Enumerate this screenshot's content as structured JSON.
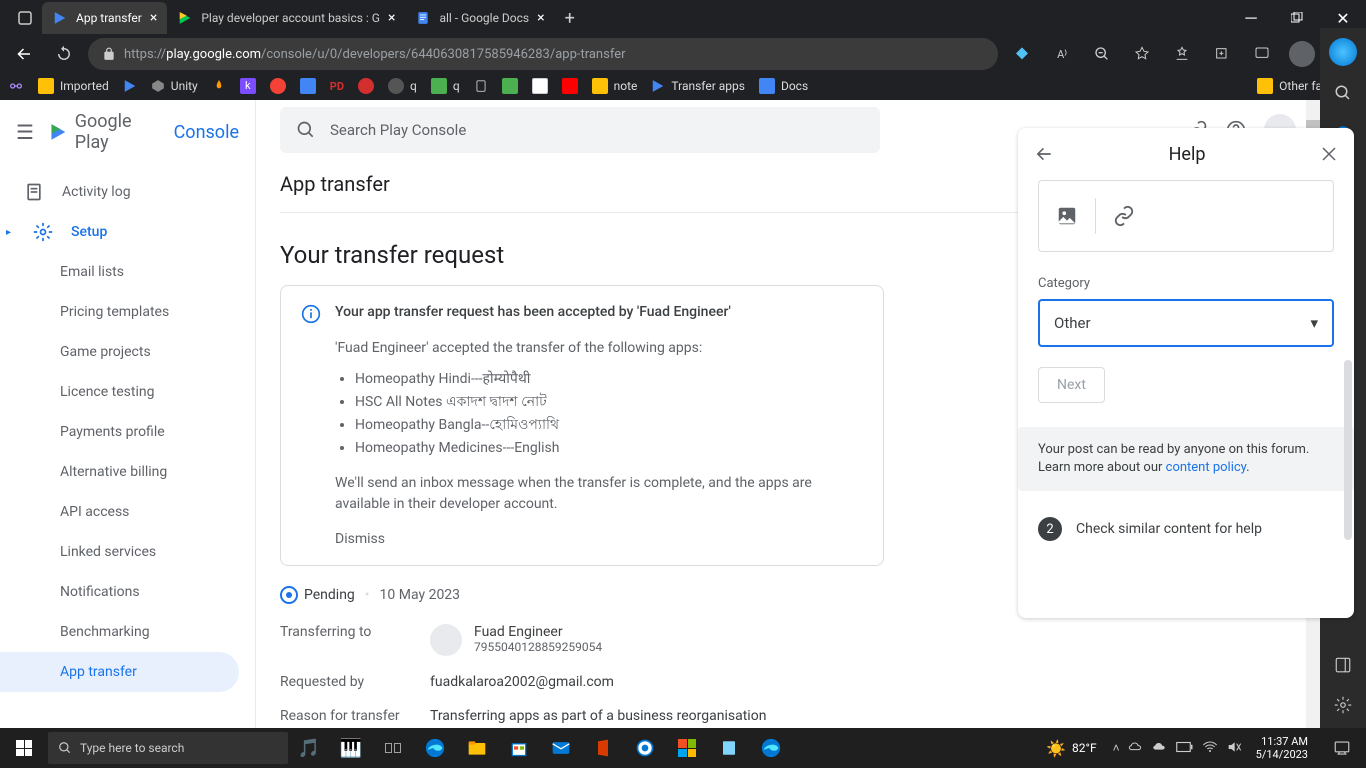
{
  "browser": {
    "tabs": [
      {
        "title": "App transfer",
        "active": true
      },
      {
        "title": "Play developer account basics : G",
        "active": false
      },
      {
        "title": "all - Google Docs",
        "active": false
      }
    ],
    "url_prefix": "https://",
    "url_host": "play.google.com",
    "url_path": "/console/u/0/developers/6440630817585946283/app-transfer",
    "bookmarks": [
      "Imported",
      "",
      "Unity",
      "",
      "",
      "",
      "",
      "",
      "",
      "q",
      "q",
      "",
      "",
      "",
      "",
      "note",
      "Transfer apps",
      "Docs"
    ],
    "other_favorites": "Other favorites"
  },
  "play": {
    "logo_text1": "Google Play",
    "logo_text2": "Console",
    "search_placeholder": "Search Play Console",
    "nav": {
      "activity_log": "Activity log",
      "setup": "Setup",
      "items": [
        "Email lists",
        "Pricing templates",
        "Game projects",
        "Licence testing",
        "Payments profile",
        "Alternative billing",
        "API access",
        "Linked services",
        "Notifications",
        "Benchmarking",
        "App transfer"
      ]
    },
    "page_title": "App transfer",
    "section_title": "Your transfer request",
    "info": {
      "title": "Your app transfer request has been accepted by 'Fuad Engineer'",
      "sub": "'Fuad Engineer' accepted the transfer of the following apps:",
      "apps": [
        "Homeopathy Hindi---होम्योपैथी",
        "HSC All Notes একাদশ দ্বাদশ নোট",
        "Homeopathy Bangla--হোমিওপ্যাথি",
        "Homeopathy Medicines---English"
      ],
      "note": "We'll send an inbox message when the transfer is complete, and the apps are available in their developer account.",
      "dismiss": "Dismiss"
    },
    "status": {
      "label": "Pending",
      "date": "10 May 2023"
    },
    "details": {
      "transferring_to_label": "Transferring to",
      "dev_name": "Fuad Engineer",
      "dev_id": "7955040128859259054",
      "requested_by_label": "Requested by",
      "requested_by": "fuadkalaroa2002@gmail.com",
      "reason_label": "Reason for transfer",
      "reason": "Transferring apps as part of a business reorganisation"
    }
  },
  "help": {
    "title": "Help",
    "category_label": "Category",
    "category_value": "Other",
    "next": "Next",
    "forum_note_1": "Your post can be read by anyone on this forum. Learn more about our ",
    "forum_note_link": "content policy",
    "step2": "Check similar content for help"
  },
  "taskbar": {
    "search_placeholder": "Type here to search",
    "temp": "82°F",
    "time": "11:37 AM",
    "date": "5/14/2023"
  }
}
